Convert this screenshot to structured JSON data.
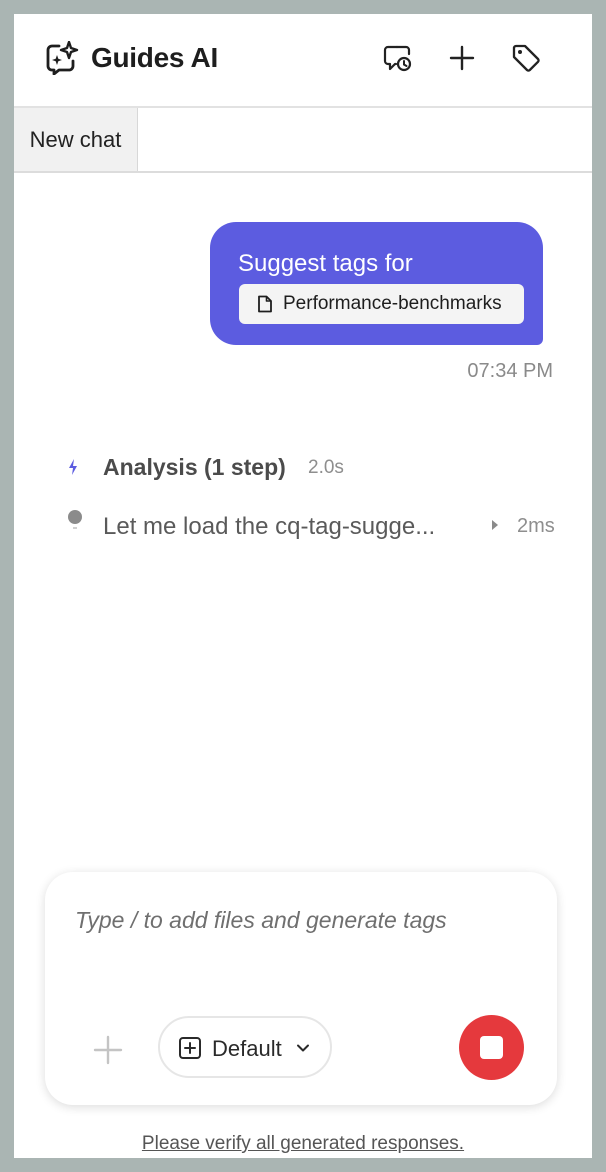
{
  "header": {
    "title": "Guides AI",
    "logo_icon": "sparkle-chat-icon",
    "actions": [
      {
        "name": "chat-history-icon"
      },
      {
        "name": "new-chat-icon"
      },
      {
        "name": "tag-icon"
      }
    ]
  },
  "tabs": [
    {
      "label": "New chat",
      "active": true
    }
  ],
  "conversation": {
    "user_message": {
      "text": "Suggest tags for",
      "attachment": "Performance-benchmarks",
      "attachment_icon": "file-icon",
      "time": "07:34 PM"
    },
    "analysis": {
      "title": "Analysis (1 step)",
      "duration": "2.0s",
      "steps": [
        {
          "text": "Let me load the cq-tag-sugge...",
          "duration": "2ms"
        }
      ]
    }
  },
  "composer": {
    "placeholder": "Type / to add files and generate tags",
    "mode": "Default",
    "stop_color": "#e5393d"
  },
  "footer": {
    "disclaimer": "Please verify all generated responses."
  },
  "colors": {
    "accent": "#5c5ce0",
    "background": "#aab5b3"
  }
}
